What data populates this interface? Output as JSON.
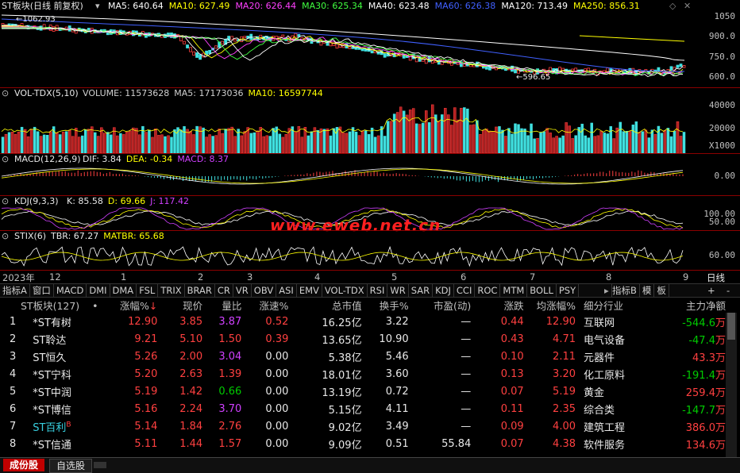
{
  "main_chart": {
    "title": "ST板块(日线 前复权)",
    "ma": [
      {
        "label": "MA5: 640.64",
        "color": "#ffffff"
      },
      {
        "label": "MA10: 627.49",
        "color": "#ffff00"
      },
      {
        "label": "MA20: 626.44",
        "color": "#ff40ff"
      },
      {
        "label": "MA30: 625.34",
        "color": "#40ff40"
      },
      {
        "label": "MA40: 623.48",
        "color": "#ffffff"
      },
      {
        "label": "MA60: 626.38",
        "color": "#4060ff"
      },
      {
        "label": "MA120: 713.49",
        "color": "#ffffff"
      },
      {
        "label": "MA250: 856.31",
        "color": "#ffff00"
      }
    ],
    "high_marker": "1062.93",
    "low_marker": "596.65",
    "y_ticks": [
      "1050",
      "900.0",
      "750.0",
      "600.0"
    ]
  },
  "volume": {
    "title": "VOL-TDX(5,10)",
    "items": [
      {
        "label": "VOLUME: 11573628",
        "color": "#d0d0d0"
      },
      {
        "label": "MA5: 17173036",
        "color": "#d0d0d0"
      },
      {
        "label": "MA10: 16597744",
        "color": "#ffff00"
      }
    ],
    "y_ticks": [
      "40000",
      "20000"
    ],
    "unit": "X1000"
  },
  "macd": {
    "title": "MACD(12,26,9)",
    "items": [
      {
        "label": "DIF: 3.84",
        "color": "#e8e8e8"
      },
      {
        "label": "DEA: -0.34",
        "color": "#ffff00"
      },
      {
        "label": "MACD: 8.37",
        "color": "#d040ff"
      }
    ],
    "y_ticks": [
      "0.00"
    ]
  },
  "kdj": {
    "title": "KDJ(9,3,3)",
    "items": [
      {
        "label": "K: 85.58",
        "color": "#e8e8e8"
      },
      {
        "label": "D: 69.66",
        "color": "#ffff00"
      },
      {
        "label": "J: 117.42",
        "color": "#d040ff"
      }
    ],
    "y_ticks": [
      "100.00",
      "50.00"
    ]
  },
  "stix": {
    "title": "STIX(6)",
    "items": [
      {
        "label": "TBR: 67.27",
        "color": "#e8e8e8"
      },
      {
        "label": "MATBR: 65.68",
        "color": "#ffff00"
      }
    ],
    "y_ticks": [
      "60.00"
    ]
  },
  "watermark": "www.eweb.net.cn",
  "date_axis": {
    "labels": [
      "2023年",
      "12",
      "1",
      "2",
      "3",
      "4",
      "5",
      "6",
      "7",
      "8",
      "9"
    ],
    "period": "日线"
  },
  "indicator_tabs": [
    "指标A",
    "窗口",
    "MACD",
    "DMI",
    "DMA",
    "FSL",
    "TRIX",
    "BRAR",
    "CR",
    "VR",
    "OBV",
    "ASI",
    "EMV",
    "VOL-TDX",
    "RSI",
    "WR",
    "SAR",
    "KDJ",
    "CCI",
    "ROC",
    "MTM",
    "BOLL",
    "PSY"
  ],
  "right_tabs": [
    "指标B",
    "模",
    "板"
  ],
  "table": {
    "group_label": "ST板块(127)",
    "dot": "•",
    "sort_indicator": "↓",
    "columns": [
      "涨幅%",
      "现价",
      "量比",
      "涨速%",
      "总市值",
      "换手%",
      "市盈(动)",
      "涨跌",
      "均涨幅%",
      "细分行业",
      "主力净额"
    ],
    "rows": [
      {
        "n": "1",
        "name": "*ST有树",
        "chg": "12.90",
        "price": "3.85",
        "vr": "3.87",
        "vrc": "mag",
        "spd": "0.52",
        "spdc": "red",
        "mcap": "16.25亿",
        "turn": "3.22",
        "pe": "—",
        "diff": "0.44",
        "avg": "12.90",
        "ind": "互联网",
        "net": "-544.6",
        "netc": "grn",
        "namec": "wht",
        "b": ""
      },
      {
        "n": "2",
        "name": "ST聆达",
        "chg": "9.21",
        "price": "5.10",
        "vr": "1.50",
        "vrc": "red",
        "spd": "0.39",
        "spdc": "red",
        "mcap": "13.65亿",
        "turn": "10.90",
        "pe": "—",
        "diff": "0.43",
        "avg": "4.71",
        "ind": "电气设备",
        "net": "-47.4",
        "netc": "grn",
        "namec": "wht",
        "b": ""
      },
      {
        "n": "3",
        "name": "ST恒久",
        "chg": "5.26",
        "price": "2.00",
        "vr": "3.04",
        "vrc": "mag",
        "spd": "0.00",
        "spdc": "wht",
        "mcap": "5.38亿",
        "turn": "5.46",
        "pe": "—",
        "diff": "0.10",
        "avg": "2.11",
        "ind": "元器件",
        "net": "43.3",
        "netc": "red",
        "namec": "wht",
        "b": ""
      },
      {
        "n": "4",
        "name": "*ST宁科",
        "chg": "5.20",
        "price": "2.63",
        "vr": "1.39",
        "vrc": "red",
        "spd": "0.00",
        "spdc": "wht",
        "mcap": "18.01亿",
        "turn": "3.60",
        "pe": "—",
        "diff": "0.13",
        "avg": "3.20",
        "ind": "化工原料",
        "net": "-191.4",
        "netc": "grn",
        "namec": "wht",
        "b": ""
      },
      {
        "n": "5",
        "name": "*ST中润",
        "chg": "5.19",
        "price": "1.42",
        "vr": "0.66",
        "vrc": "grn",
        "spd": "0.00",
        "spdc": "wht",
        "mcap": "13.19亿",
        "turn": "0.72",
        "pe": "—",
        "diff": "0.07",
        "avg": "5.19",
        "ind": "黄金",
        "net": "259.4",
        "netc": "red",
        "namec": "wht",
        "b": ""
      },
      {
        "n": "6",
        "name": "*ST博信",
        "chg": "5.16",
        "price": "2.24",
        "vr": "3.70",
        "vrc": "mag",
        "spd": "0.00",
        "spdc": "wht",
        "mcap": "5.15亿",
        "turn": "4.11",
        "pe": "—",
        "diff": "0.11",
        "avg": "2.35",
        "ind": "综合类",
        "net": "-147.7",
        "netc": "grn",
        "namec": "wht",
        "b": ""
      },
      {
        "n": "7",
        "name": "ST百利",
        "chg": "5.14",
        "price": "1.84",
        "vr": "2.76",
        "vrc": "red",
        "spd": "0.00",
        "spdc": "wht",
        "mcap": "9.02亿",
        "turn": "3.49",
        "pe": "—",
        "diff": "0.09",
        "avg": "4.00",
        "ind": "建筑工程",
        "net": "386.0",
        "netc": "red",
        "namec": "cyn",
        "b": "B"
      },
      {
        "n": "8",
        "name": "*ST信通",
        "chg": "5.11",
        "price": "1.44",
        "vr": "1.57",
        "vrc": "red",
        "spd": "0.00",
        "spdc": "wht",
        "mcap": "9.09亿",
        "turn": "0.51",
        "pe": "55.84",
        "diff": "0.07",
        "avg": "4.38",
        "ind": "软件服务",
        "net": "134.6",
        "netc": "red",
        "namec": "wht",
        "b": ""
      }
    ],
    "net_unit": "万"
  },
  "bottom_tabs": [
    "成份股",
    "自选股"
  ]
}
